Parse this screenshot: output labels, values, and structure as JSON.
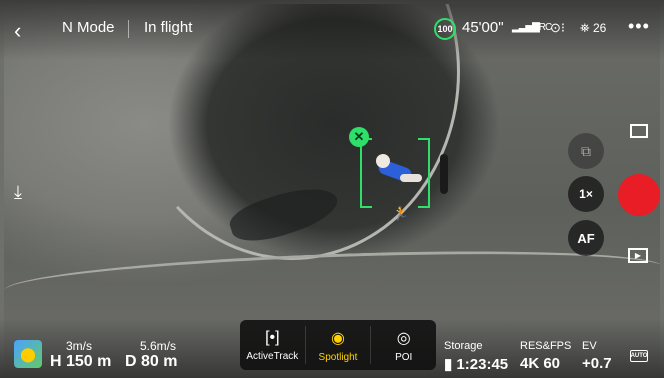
{
  "header": {
    "back_icon": "chevron-left-icon",
    "flight_mode": "N Mode",
    "status": "In flight",
    "battery_percent": "100",
    "flight_time": "45'00\"",
    "signal_label": "RC",
    "satellites": "26"
  },
  "tracking": {
    "cancel_symbol": "✕",
    "runner_symbol": "🏃"
  },
  "right_controls": {
    "zoom_label": "1×",
    "focus_label": "AF",
    "shutter_color": "#e81d25"
  },
  "telemetry": {
    "horizontal_speed": "3m/s",
    "vertical_speed": "5.6m/s",
    "height": "H 150 m",
    "distance": "D 80 m"
  },
  "smart_modes": [
    {
      "label": "ActiveTrack",
      "icon": "activetrack-icon",
      "glyph": "[•]"
    },
    {
      "label": "Spotlight",
      "icon": "eye-icon",
      "glyph": "◉"
    },
    {
      "label": "POI",
      "icon": "poi-icon",
      "glyph": "◎"
    }
  ],
  "camera_stats": {
    "storage_label": "Storage",
    "storage_value": "1:23:45",
    "res_label": "RES&FPS",
    "res_value": "4K 60",
    "ev_label": "EV",
    "ev_value": "+0.7",
    "auto_label": "AUTO"
  },
  "colors": {
    "track_green": "#2ee06a",
    "active_mode": "#ffd200"
  }
}
